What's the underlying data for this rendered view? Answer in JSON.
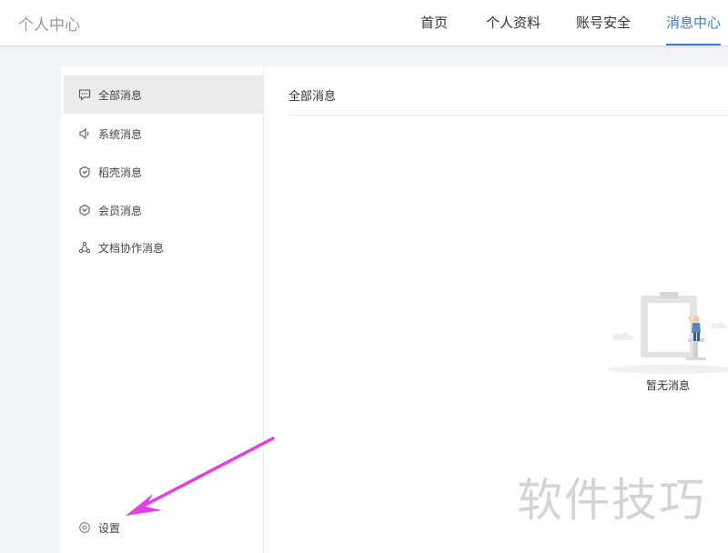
{
  "header": {
    "title": "个人中心",
    "nav": [
      {
        "label": "首页"
      },
      {
        "label": "个人资料"
      },
      {
        "label": "账号安全"
      },
      {
        "label": "消息中心",
        "active": true
      }
    ]
  },
  "sidebar": {
    "items": [
      {
        "label": "全部消息",
        "icon": "chat-bubble-icon",
        "active": true
      },
      {
        "label": "系统消息",
        "icon": "speaker-icon"
      },
      {
        "label": "稻壳消息",
        "icon": "docer-shield-icon"
      },
      {
        "label": "会员消息",
        "icon": "member-hexagon-icon"
      },
      {
        "label": "文档协作消息",
        "icon": "share-triangle-icon"
      }
    ],
    "settings": {
      "label": "设置",
      "icon": "gear-icon"
    }
  },
  "main": {
    "title": "全部消息",
    "empty_text": "暂无消息"
  },
  "watermark": "软件技巧",
  "colors": {
    "accent": "#3f7cc6",
    "annotation_arrow": "#e23fe6"
  }
}
